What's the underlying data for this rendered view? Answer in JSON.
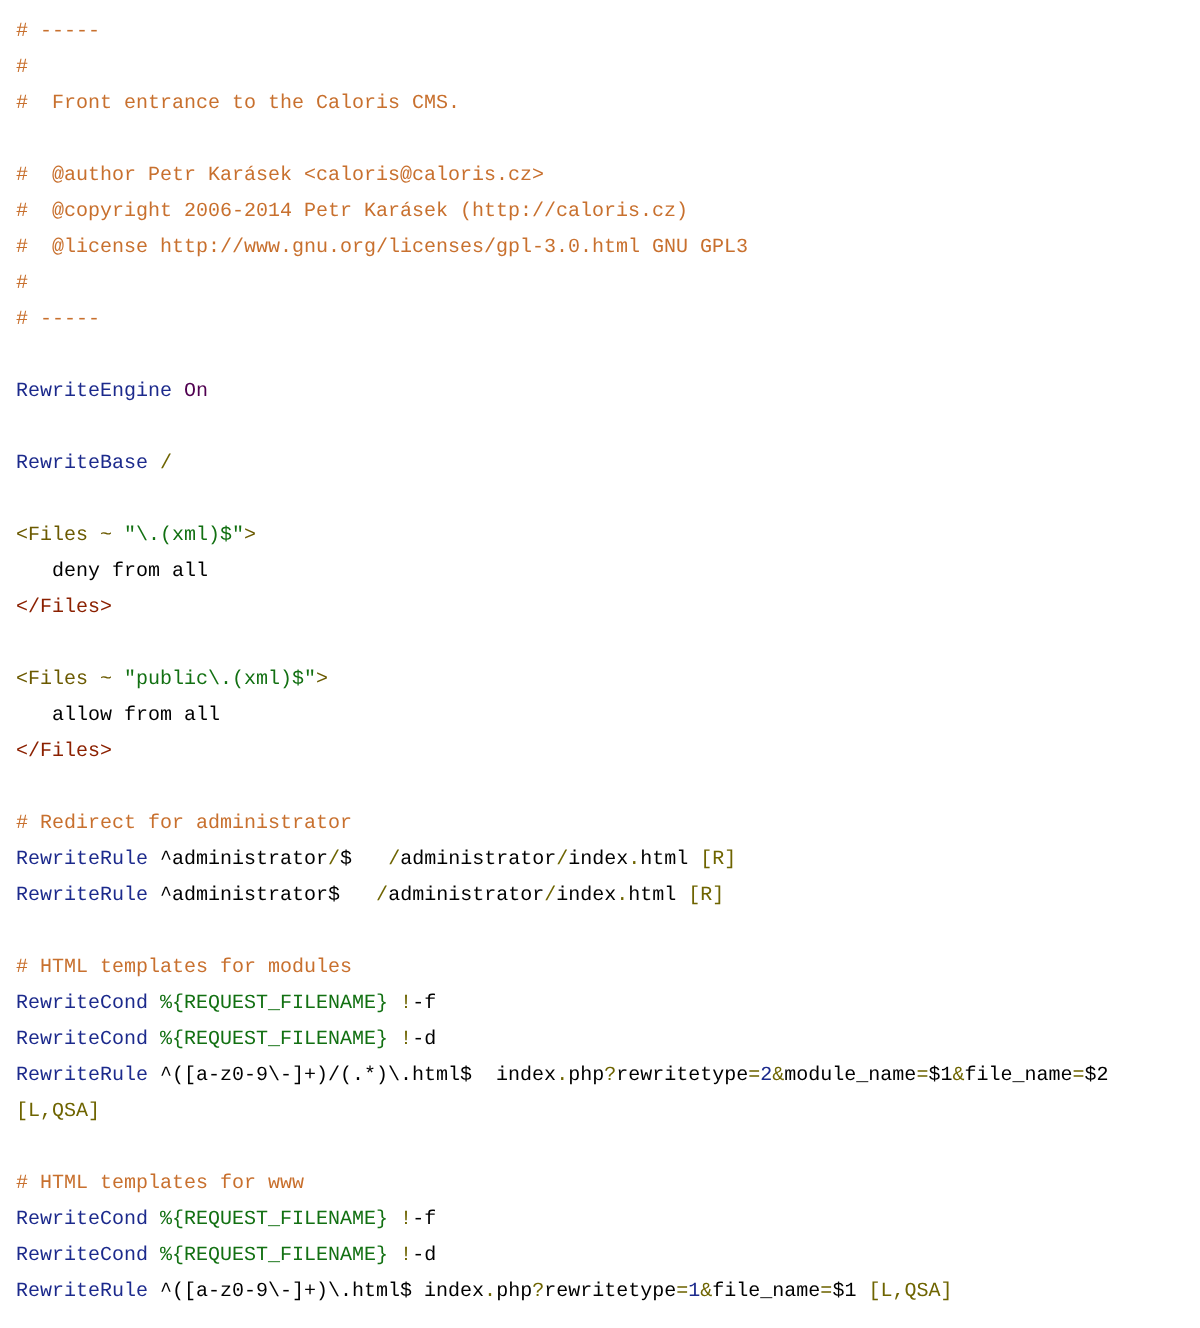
{
  "code": {
    "blocks": [
      {
        "lines": [
          {
            "tokens": [
              {
                "kind": "comment",
                "text": "# -----"
              }
            ]
          },
          {
            "tokens": [
              {
                "kind": "comment",
                "text": "#"
              }
            ]
          },
          {
            "tokens": [
              {
                "kind": "comment",
                "text": "#  Front entrance to the Caloris CMS."
              }
            ]
          }
        ]
      },
      {
        "lines": [
          {
            "tokens": [
              {
                "kind": "comment",
                "text": "#  @author Petr Karásek <caloris@caloris.cz>"
              }
            ]
          },
          {
            "tokens": [
              {
                "kind": "comment",
                "text": "#  @copyright 2006-2014 Petr Karásek (http://caloris.cz)"
              }
            ]
          },
          {
            "tokens": [
              {
                "kind": "comment",
                "text": "#  @license http://www.gnu.org/licenses/gpl-3.0.html GNU GPL3"
              }
            ]
          },
          {
            "tokens": [
              {
                "kind": "comment",
                "text": "#"
              }
            ]
          },
          {
            "tokens": [
              {
                "kind": "comment",
                "text": "# -----"
              }
            ]
          }
        ]
      },
      {
        "lines": [
          {
            "tokens": [
              {
                "kind": "keyword",
                "text": "RewriteEngine"
              },
              {
                "kind": "value",
                "text": " On"
              }
            ]
          }
        ]
      },
      {
        "lines": [
          {
            "tokens": [
              {
                "kind": "keyword",
                "text": "RewriteBase"
              },
              {
                "kind": "punct",
                "text": " /"
              }
            ]
          }
        ]
      },
      {
        "lines": [
          {
            "tokens": [
              {
                "kind": "tag",
                "text": "<Files ~ "
              },
              {
                "kind": "string",
                "text": "\"\\.(xml)$\""
              },
              {
                "kind": "tag",
                "text": ">"
              }
            ]
          },
          {
            "tokens": [
              {
                "kind": "text",
                "text": "   deny from all"
              }
            ]
          },
          {
            "tokens": [
              {
                "kind": "close",
                "text": "</Files>"
              }
            ]
          }
        ]
      },
      {
        "lines": [
          {
            "tokens": [
              {
                "kind": "tag",
                "text": "<Files ~ "
              },
              {
                "kind": "string",
                "text": "\"public\\.(xml)$\""
              },
              {
                "kind": "tag",
                "text": ">"
              }
            ]
          },
          {
            "tokens": [
              {
                "kind": "text",
                "text": "   allow from all"
              }
            ]
          },
          {
            "tokens": [
              {
                "kind": "close",
                "text": "</Files>"
              }
            ]
          }
        ]
      },
      {
        "lines": [
          {
            "tokens": [
              {
                "kind": "comment",
                "text": "# Redirect for administrator"
              }
            ]
          },
          {
            "tokens": [
              {
                "kind": "keyword",
                "text": "RewriteRule"
              },
              {
                "kind": "text",
                "text": " ^administrator"
              },
              {
                "kind": "punct",
                "text": "/"
              },
              {
                "kind": "text",
                "text": "$   "
              },
              {
                "kind": "punct",
                "text": "/"
              },
              {
                "kind": "text",
                "text": "administrator"
              },
              {
                "kind": "punct",
                "text": "/"
              },
              {
                "kind": "text",
                "text": "index"
              },
              {
                "kind": "punct",
                "text": "."
              },
              {
                "kind": "text",
                "text": "html "
              },
              {
                "kind": "punct",
                "text": "[R]"
              }
            ]
          },
          {
            "tokens": [
              {
                "kind": "keyword",
                "text": "RewriteRule"
              },
              {
                "kind": "text",
                "text": " ^administrator$   "
              },
              {
                "kind": "punct",
                "text": "/"
              },
              {
                "kind": "text",
                "text": "administrator"
              },
              {
                "kind": "punct",
                "text": "/"
              },
              {
                "kind": "text",
                "text": "index"
              },
              {
                "kind": "punct",
                "text": "."
              },
              {
                "kind": "text",
                "text": "html "
              },
              {
                "kind": "punct",
                "text": "[R]"
              }
            ]
          }
        ]
      },
      {
        "lines": [
          {
            "tokens": [
              {
                "kind": "comment",
                "text": "# HTML templates for modules"
              }
            ]
          },
          {
            "tokens": [
              {
                "kind": "keyword",
                "text": "RewriteCond"
              },
              {
                "kind": "var",
                "text": " %{REQUEST_FILENAME}"
              },
              {
                "kind": "punct",
                "text": " !"
              },
              {
                "kind": "text",
                "text": "-f"
              }
            ]
          },
          {
            "tokens": [
              {
                "kind": "keyword",
                "text": "RewriteCond"
              },
              {
                "kind": "var",
                "text": " %{REQUEST_FILENAME}"
              },
              {
                "kind": "punct",
                "text": " !"
              },
              {
                "kind": "text",
                "text": "-d"
              }
            ]
          },
          {
            "tokens": [
              {
                "kind": "keyword",
                "text": "RewriteRule"
              },
              {
                "kind": "text",
                "text": " ^([a-z0-9\\-]+)/(.*)\\.html$  index"
              },
              {
                "kind": "punct",
                "text": "."
              },
              {
                "kind": "text",
                "text": "php"
              },
              {
                "kind": "punct",
                "text": "?"
              },
              {
                "kind": "text",
                "text": "rewritetype"
              },
              {
                "kind": "punct",
                "text": "="
              },
              {
                "kind": "number",
                "text": "2"
              },
              {
                "kind": "punct",
                "text": "&"
              },
              {
                "kind": "text",
                "text": "module_name"
              },
              {
                "kind": "punct",
                "text": "="
              },
              {
                "kind": "text",
                "text": "$1"
              },
              {
                "kind": "punct",
                "text": "&"
              },
              {
                "kind": "text",
                "text": "file_name"
              },
              {
                "kind": "punct",
                "text": "="
              },
              {
                "kind": "text",
                "text": "$2 "
              },
              {
                "kind": "punct",
                "text": "[L,QSA]"
              }
            ]
          }
        ]
      },
      {
        "lines": [
          {
            "tokens": [
              {
                "kind": "comment",
                "text": "# HTML templates for www"
              }
            ]
          },
          {
            "tokens": [
              {
                "kind": "keyword",
                "text": "RewriteCond"
              },
              {
                "kind": "var",
                "text": " %{REQUEST_FILENAME}"
              },
              {
                "kind": "punct",
                "text": " !"
              },
              {
                "kind": "text",
                "text": "-f"
              }
            ]
          },
          {
            "tokens": [
              {
                "kind": "keyword",
                "text": "RewriteCond"
              },
              {
                "kind": "var",
                "text": " %{REQUEST_FILENAME}"
              },
              {
                "kind": "punct",
                "text": " !"
              },
              {
                "kind": "text",
                "text": "-d"
              }
            ]
          },
          {
            "tokens": [
              {
                "kind": "keyword",
                "text": "RewriteRule"
              },
              {
                "kind": "text",
                "text": " ^([a-z0-9\\-]+)\\.html$ index"
              },
              {
                "kind": "punct",
                "text": "."
              },
              {
                "kind": "text",
                "text": "php"
              },
              {
                "kind": "punct",
                "text": "?"
              },
              {
                "kind": "text",
                "text": "rewritetype"
              },
              {
                "kind": "punct",
                "text": "="
              },
              {
                "kind": "number",
                "text": "1"
              },
              {
                "kind": "punct",
                "text": "&"
              },
              {
                "kind": "text",
                "text": "file_name"
              },
              {
                "kind": "punct",
                "text": "="
              },
              {
                "kind": "text",
                "text": "$1 "
              },
              {
                "kind": "punct",
                "text": "[L,QSA]"
              }
            ]
          }
        ]
      }
    ]
  }
}
